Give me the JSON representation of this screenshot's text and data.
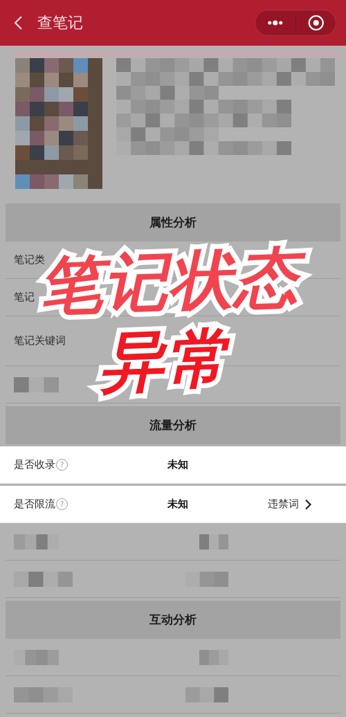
{
  "header": {
    "title": "查笔记"
  },
  "sections": [
    {
      "title": "属性分析",
      "rows": [
        {
          "kind": "label",
          "label": "笔记类",
          "highlighted": false
        },
        {
          "kind": "label",
          "label": "笔记",
          "highlighted": false
        },
        {
          "kind": "label_pixelated",
          "label": "笔记关键词",
          "highlighted": false
        },
        {
          "kind": "pixelated_left",
          "highlighted": false
        }
      ]
    },
    {
      "title": "流量分析",
      "rows": [
        {
          "kind": "status",
          "label": "是否收录",
          "help": "?",
          "value": "未知",
          "highlighted": true
        },
        {
          "kind": "status",
          "label": "是否限流",
          "help": "?",
          "value": "未知",
          "link": "违禁词",
          "highlighted": true
        },
        {
          "kind": "pixelated",
          "highlighted": false
        },
        {
          "kind": "pixelated",
          "highlighted": false
        }
      ]
    },
    {
      "title": "互动分析",
      "rows": [
        {
          "kind": "pixelated",
          "highlighted": false
        },
        {
          "kind": "pixelated",
          "highlighted": false
        }
      ]
    }
  ],
  "overlay": {
    "lines": [
      "笔记状态",
      "异常"
    ]
  }
}
